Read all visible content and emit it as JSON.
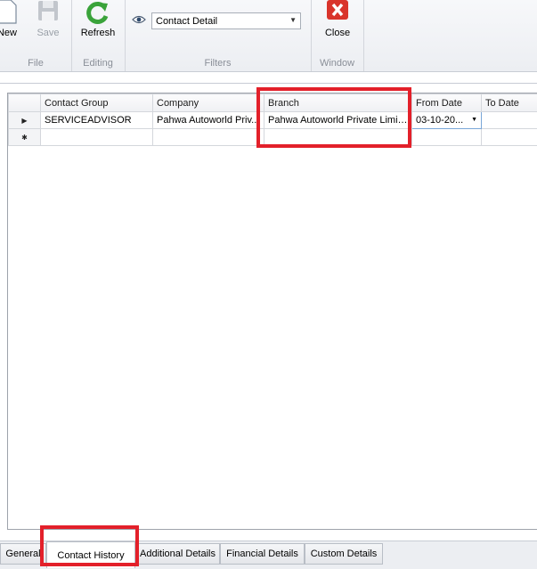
{
  "ribbon": {
    "buttons": {
      "new_label": "New",
      "save_label": "Save",
      "refresh_label": "Refresh",
      "close_label": "Close"
    },
    "groups": {
      "file": "File",
      "editing": "Editing",
      "filters": "Filters",
      "window": "Window"
    },
    "filter_select": {
      "value": "Contact  Detail"
    }
  },
  "grid": {
    "columns": [
      "Contact Group",
      "Company",
      "Branch",
      "From Date",
      "To Date"
    ],
    "rows": [
      {
        "contact_group": "SERVICEADVISOR",
        "company": "Pahwa Autoworld Priv...",
        "branch": "Pahwa Autoworld Private Limit...",
        "from_date": "03-10-20...",
        "to_date": ""
      }
    ]
  },
  "tabs": [
    "General",
    "Contact History",
    "Additional Details",
    "Financial Details",
    "Custom Details"
  ],
  "active_tab": "Contact History",
  "colors": {
    "highlight": "#e3202a",
    "refresh_green": "#3aa33a",
    "close_red": "#d9342b"
  }
}
